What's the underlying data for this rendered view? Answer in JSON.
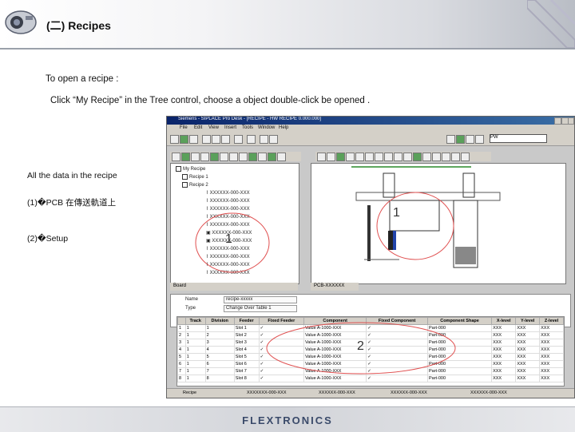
{
  "slide": {
    "title": "(二) Recipes",
    "line1": "To open a recipe :",
    "line2": "Click “My Recipe” in the Tree control, choose a object double-click be opened .",
    "side_label": "All the data in the recipe",
    "item1": "(1)�PCB 在傳送軌道上",
    "item2": "(2)�Setup",
    "brand": "FLEXTRONICS"
  },
  "screenshot": {
    "window_title": "Siemens - SIPLACE Pro Desk - [RECIPE - HW RECIPE 0.000.000]",
    "menu": [
      "File",
      "Edit",
      "View",
      "Insert",
      "Tools",
      "Window",
      "Help"
    ],
    "combo_value": "PW",
    "tree_items": [
      "My Recipe",
      "Recipe 1",
      "Recipe 2",
      "XXXXXX-000-XXX",
      "XXXXXX-000-XXX",
      "XXXXXX-000-XXX",
      "XXXXXX-000-XXX",
      "XXXXXX-000-XXX",
      "XXXXXX-000-XXX",
      "XXXXXX-000-XXX",
      "XXXXXX-000-XXX",
      "XXXXXX-000-XXX",
      "XXXXXX-000-XXX",
      "XXXXXX-000-XXX"
    ],
    "tab_left": "Board",
    "tab_right": "PCB-XXXXXX",
    "props": {
      "name_label": "Name",
      "name_value": "recipe-xxxxx",
      "type_label": "Type",
      "type_value": "Change Over Table 1"
    },
    "grid_headers": [
      "",
      "Track",
      "Division",
      "Feeder",
      "Fixed Feeder",
      "Component",
      "Fixed Component",
      "Component Shape",
      "X-level",
      "Y-level",
      "Z-level"
    ],
    "grid_rows": [
      [
        "1",
        "1",
        "1",
        "Slot 1",
        "✓",
        "Value A-1000-XXX",
        "✓",
        "Part-000",
        "XXX",
        "XXX",
        "XXX"
      ],
      [
        "2",
        "1",
        "2",
        "Slot 2",
        "✓",
        "Value A-1000-XXX",
        "✓",
        "Part-000",
        "XXX",
        "XXX",
        "XXX"
      ],
      [
        "3",
        "1",
        "3",
        "Slot 3",
        "✓",
        "Value A-1000-XXX",
        "✓",
        "Part-000",
        "XXX",
        "XXX",
        "XXX"
      ],
      [
        "4",
        "1",
        "4",
        "Slot 4",
        "✓",
        "Value A-1000-XXX",
        "✓",
        "Part-000",
        "XXX",
        "XXX",
        "XXX"
      ],
      [
        "5",
        "1",
        "5",
        "Slot 5",
        "✓",
        "Value A-1000-XXX",
        "✓",
        "Part-000",
        "XXX",
        "XXX",
        "XXX"
      ],
      [
        "6",
        "1",
        "6",
        "Slot 6",
        "✓",
        "Value A-1000-XXX",
        "✓",
        "Part-000",
        "XXX",
        "XXX",
        "XXX"
      ],
      [
        "7",
        "1",
        "7",
        "Slot 7",
        "✓",
        "Value A-1000-XXX",
        "✓",
        "Part-000",
        "XXX",
        "XXX",
        "XXX"
      ],
      [
        "8",
        "1",
        "8",
        "Slot 8",
        "✓",
        "Value A-1000-XXX",
        "✓",
        "Part-000",
        "XXX",
        "XXX",
        "XXX"
      ]
    ],
    "status_items": [
      "Recipe",
      "XXXXXXX-000-XXX",
      "XXXXXX-000-XXX",
      "XXXXXX-000-XXX",
      "XXXXXX-000-XXX"
    ],
    "marker1": "1",
    "marker2": "2",
    "marker1_top": "1"
  }
}
